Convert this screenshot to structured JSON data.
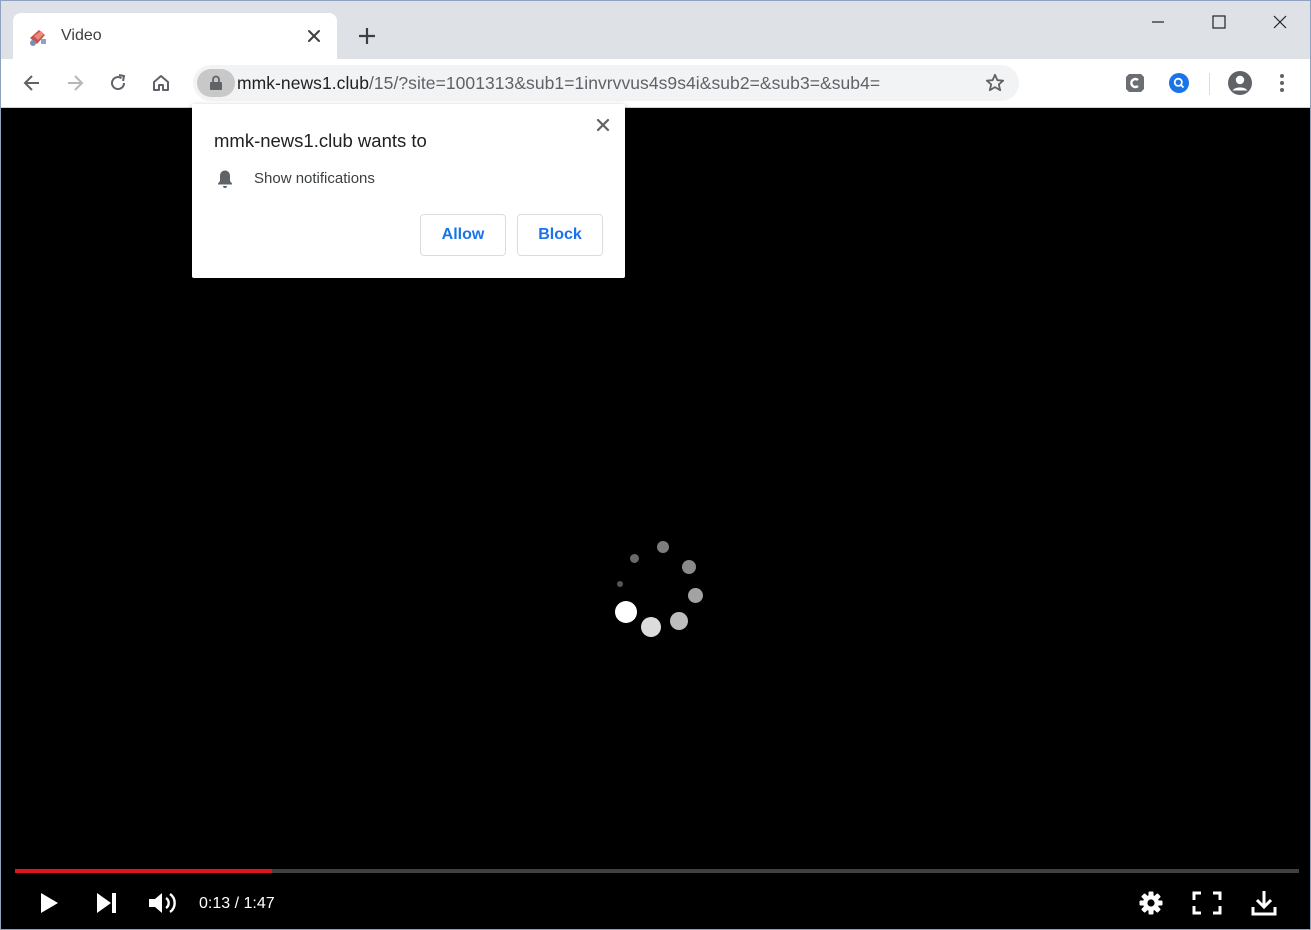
{
  "tab": {
    "title": "Video"
  },
  "address_bar": {
    "host": "mmk-news1.club",
    "path": "/15/?site=1001313&sub1=1invrvvus4s9s4i&sub2=&sub3=&sub4="
  },
  "permission_popup": {
    "title": "mmk-news1.club wants to",
    "permission": "Show notifications",
    "allow_label": "Allow",
    "block_label": "Block"
  },
  "video_player": {
    "current_time": "0:13",
    "duration": "1:47",
    "time_separator": " / ",
    "progress_fraction": 0.2
  },
  "colors": {
    "progress_red": "#e3141d",
    "link_blue": "#1a73e8",
    "tabstrip_gray": "#dee1e6"
  },
  "icons": {
    "toolbar": [
      "back-icon",
      "forward-icon",
      "reload-icon",
      "home-icon",
      "lock-icon",
      "star-icon",
      "extension-c-icon",
      "extension-search-icon",
      "profile-icon",
      "menu-icon"
    ],
    "player": [
      "play-icon",
      "next-icon",
      "volume-icon",
      "settings-icon",
      "fullscreen-icon",
      "download-icon"
    ]
  }
}
